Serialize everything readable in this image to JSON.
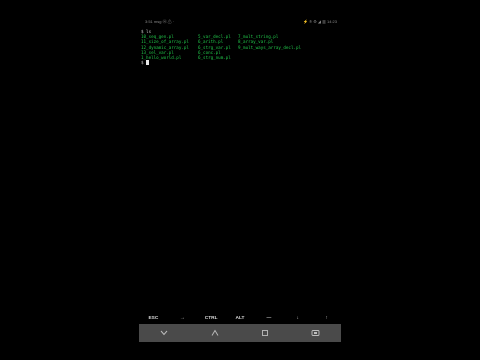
{
  "statusbar": {
    "left_text": "3:51 msg Ⓝ ⚠ ·",
    "right_text": "⚡ ® ⚙ ◢ ▥ 14:23"
  },
  "terminal": {
    "prompt_cmd": "$ ls",
    "rows": [
      [
        "10_seq_gen.pl",
        "5_var_decl.pl",
        "7_mult_string.pl"
      ],
      [
        "11_size_of_array.pl",
        "6_arith.pl",
        "8_array_var.pl"
      ],
      [
        "12_dynamic_array.pl",
        "6_strg_var.pl",
        "9_mult_ways_array_decl.pl"
      ],
      [
        "13_sel_var.pl",
        "6_conc.pl",
        ""
      ],
      [
        "1_hello_world.pl",
        "6_strg_num.pl",
        ""
      ]
    ],
    "prompt": "$"
  },
  "extra_keys": [
    "ESC",
    "→",
    "CTRL",
    "ALT",
    "—",
    "↓",
    "↑"
  ],
  "navbar": {
    "icons": [
      "chevron-down-icon",
      "home-icon",
      "back-icon",
      "recent-apps-icon"
    ]
  }
}
